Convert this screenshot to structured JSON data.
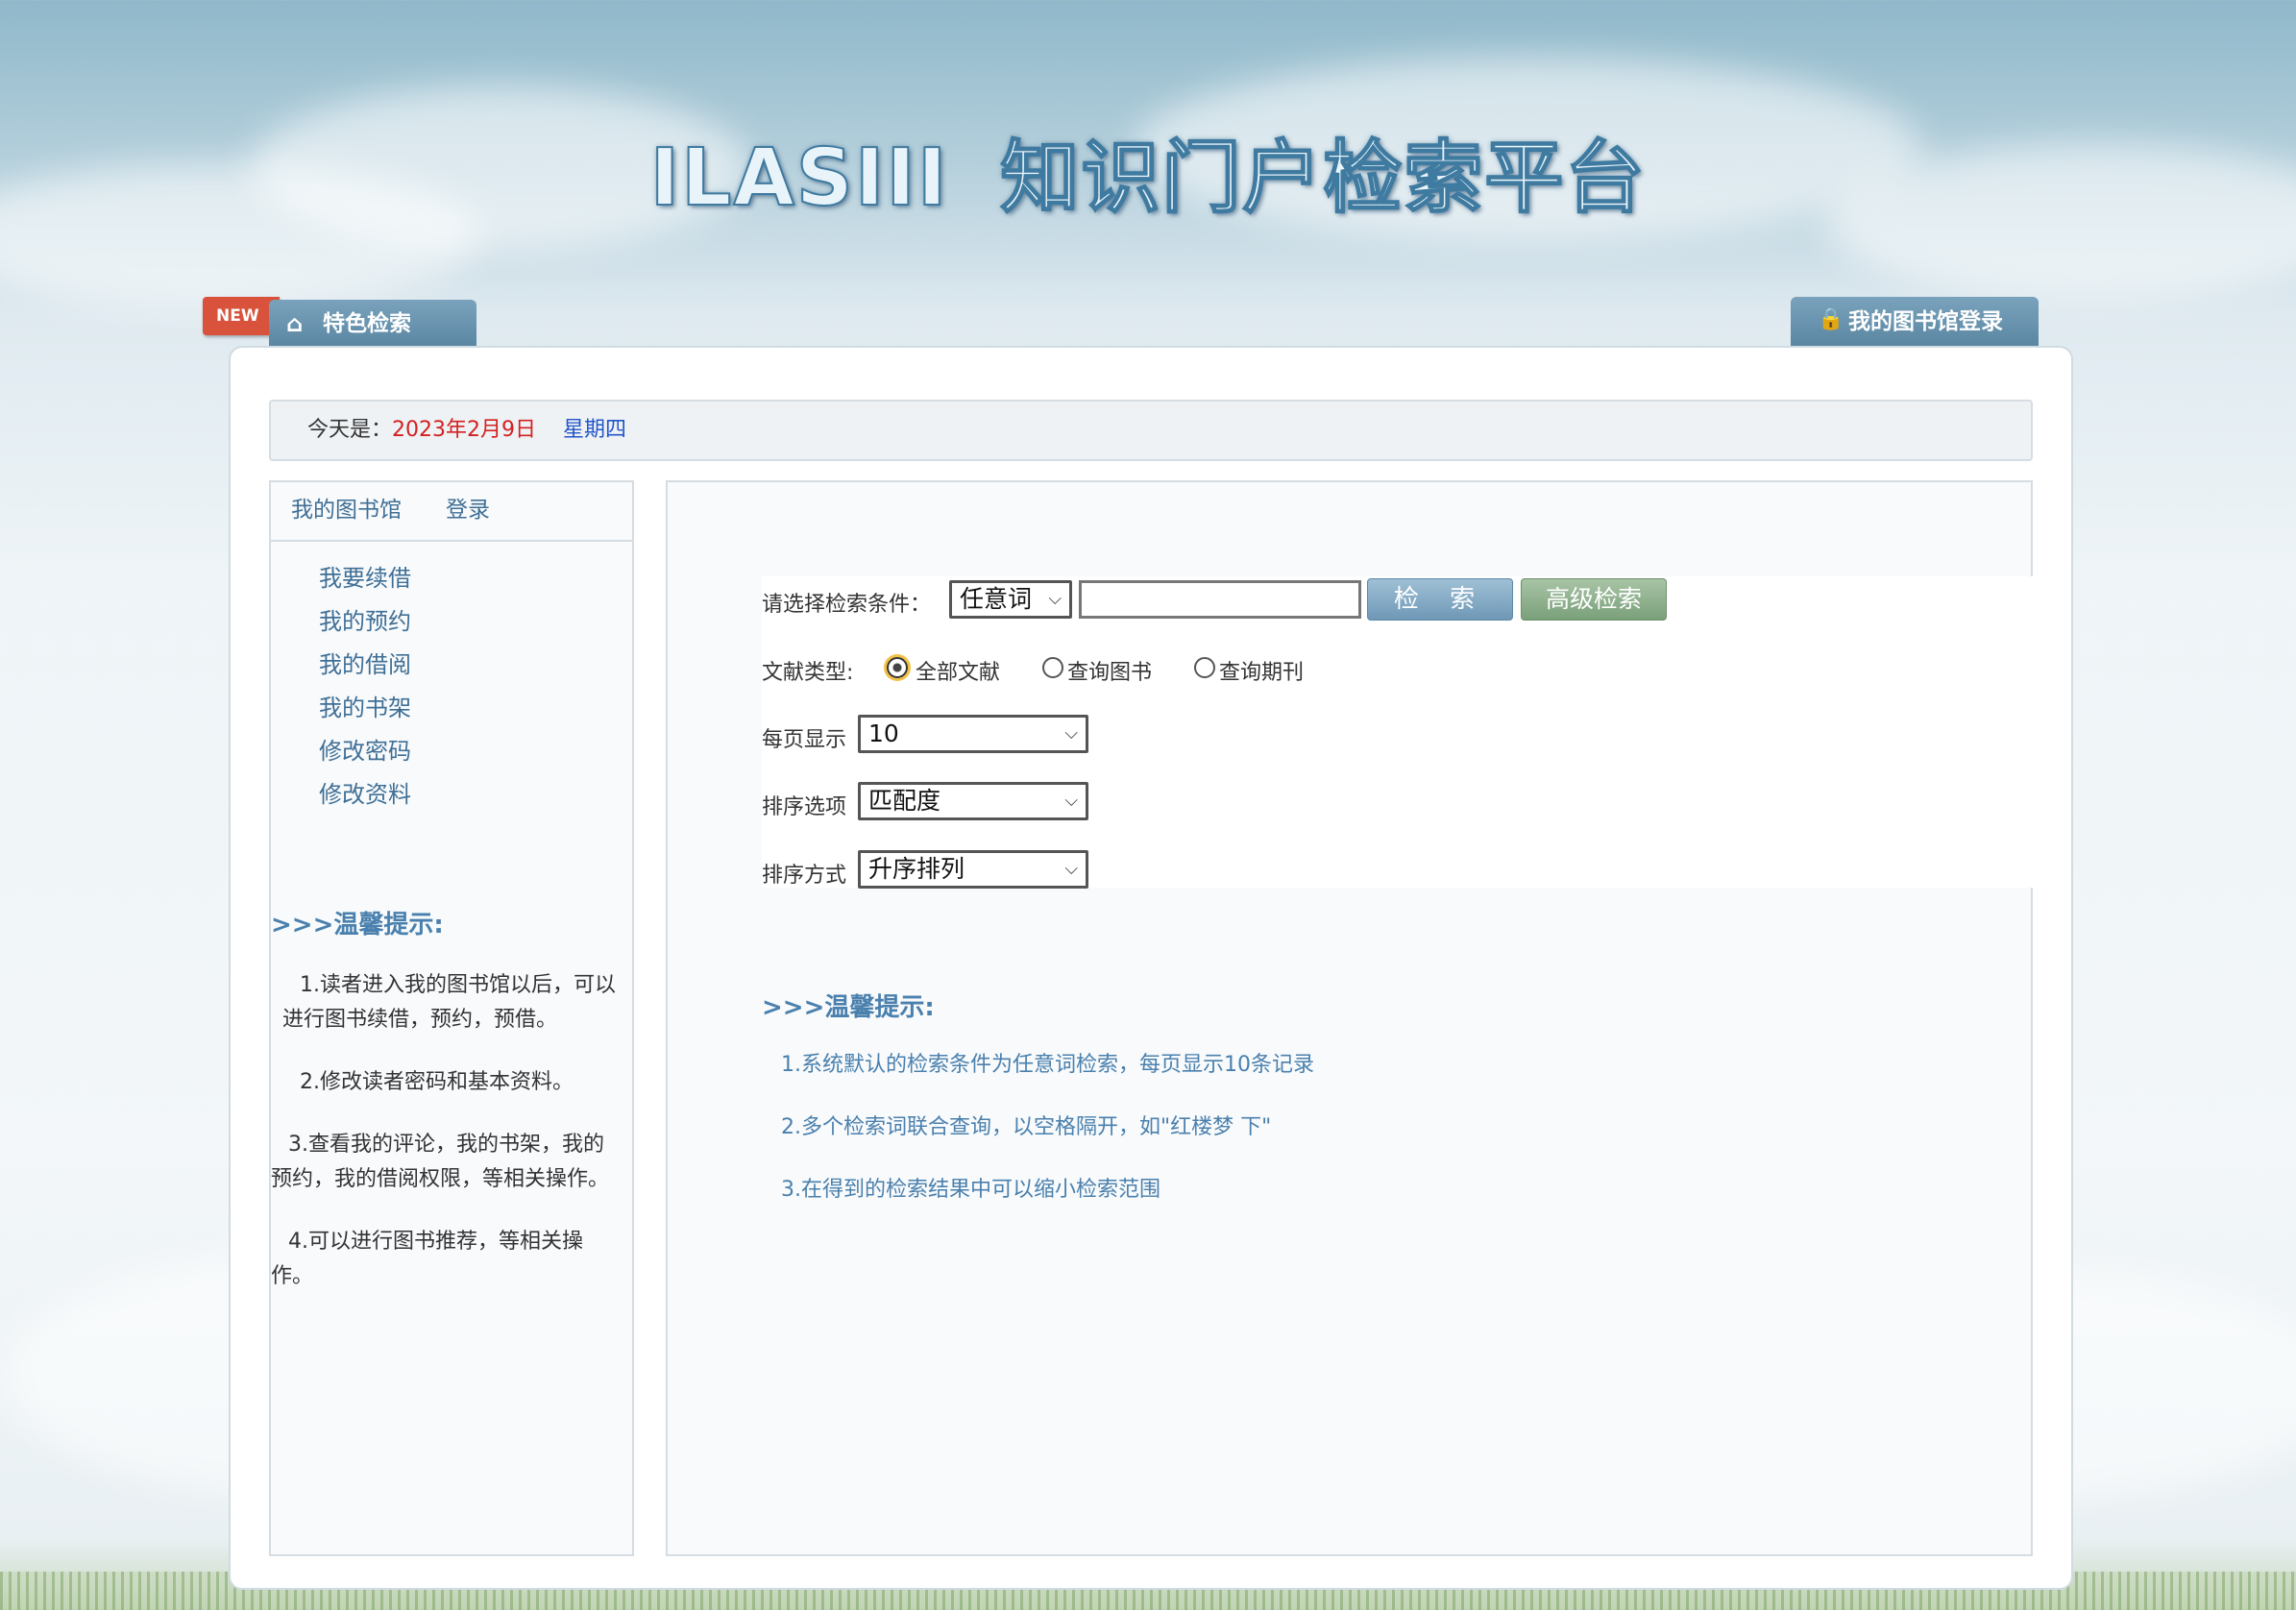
{
  "header": {
    "brand": "ILASIII",
    "title": "知识门户检索平台"
  },
  "tabs": {
    "new_badge": "NEW",
    "featured_search": "特色检索",
    "my_library_login": "我的图书馆登录"
  },
  "datebar": {
    "label": "今天是：",
    "date": "2023年2月9日",
    "weekday": "星期四"
  },
  "sidebar": {
    "head": {
      "my_library": "我的图书馆",
      "login": "登录"
    },
    "items": [
      {
        "label": "我要续借"
      },
      {
        "label": "我的预约"
      },
      {
        "label": "我的借阅"
      },
      {
        "label": "我的书架"
      },
      {
        "label": "修改密码"
      },
      {
        "label": "修改资料"
      }
    ],
    "tips_title": ">>>温馨提示:",
    "tips": [
      "1.读者进入我的图书馆以后，可以 进行图书续借，预约，预借。",
      "2.修改读者密码和基本资料。",
      "3.查看我的评论，我的书架，我的预约，我的借阅权限，等相关操作。",
      "4.可以进行图书推荐，等相关操作。"
    ]
  },
  "search": {
    "condition_label": "请选择检索条件：",
    "condition_value": "任意词",
    "query_value": "",
    "search_button": "检 索",
    "advanced_button": "高级检索",
    "doc_type_label": "文献类型:",
    "doc_types": [
      {
        "label": "全部文献",
        "checked": true
      },
      {
        "label": "查询图书",
        "checked": false
      },
      {
        "label": "查询期刊",
        "checked": false
      }
    ],
    "per_page_label": "每页显示",
    "per_page_value": "10",
    "sort_option_label": "排序选项",
    "sort_option_value": "匹配度",
    "sort_order_label": "排序方式",
    "sort_order_value": "升序排列"
  },
  "main_tips": {
    "title": ">>>温馨提示:",
    "items": [
      "1.系统默认的检索条件为任意词检索，每页显示10条记录",
      "2.多个检索词联合查询，以空格隔开，如\"红楼梦 下\"",
      "3.在得到的检索结果中可以缩小检索范围"
    ]
  }
}
